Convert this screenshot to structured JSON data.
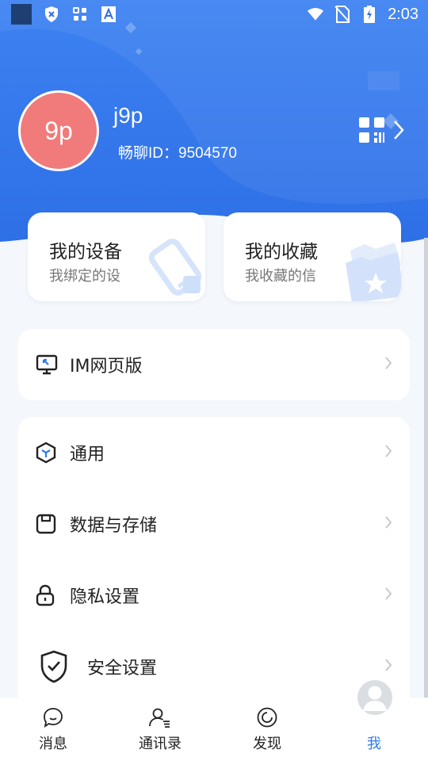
{
  "status_bar": {
    "time": "2:03",
    "left_icons": [
      "app-square-icon",
      "shield-x-icon",
      "apps-grid-icon",
      "a-letter-icon"
    ],
    "right_icons": [
      "wifi-icon",
      "no-sim-icon",
      "battery-charging-icon"
    ]
  },
  "profile": {
    "avatar_text": "9p",
    "avatar_color": "#f17a7a",
    "name": "j9p",
    "id_label": "畅聊ID：9504570"
  },
  "cards": [
    {
      "title": "我的设备",
      "subtitle": "我绑定的设",
      "icon": "device-icon"
    },
    {
      "title": "我的收藏",
      "subtitle": "我收藏的信",
      "icon": "folder-star-icon"
    }
  ],
  "menu_groups": [
    {
      "items": [
        {
          "label": "IM网页版",
          "icon": "monitor-icon"
        }
      ]
    },
    {
      "items": [
        {
          "label": "通用",
          "icon": "cube-icon"
        },
        {
          "label": "数据与存储",
          "icon": "storage-icon"
        },
        {
          "label": "隐私设置",
          "icon": "lock-icon"
        },
        {
          "label": "安全设置",
          "icon": "shield-check-icon"
        }
      ]
    }
  ],
  "bottom_nav": [
    {
      "label": "消息",
      "icon": "chat-bubble-icon",
      "active": false
    },
    {
      "label": "通讯录",
      "icon": "contacts-icon",
      "active": false
    },
    {
      "label": "发现",
      "icon": "compass-icon",
      "active": false
    },
    {
      "label": "我",
      "icon": "user-avatar-icon",
      "active": true
    }
  ],
  "colors": {
    "accent": "#2f7bea",
    "header_gradient_top": "#3a7ff0",
    "header_gradient_bottom": "#2f6fe6",
    "background": "#f4f7fb"
  }
}
